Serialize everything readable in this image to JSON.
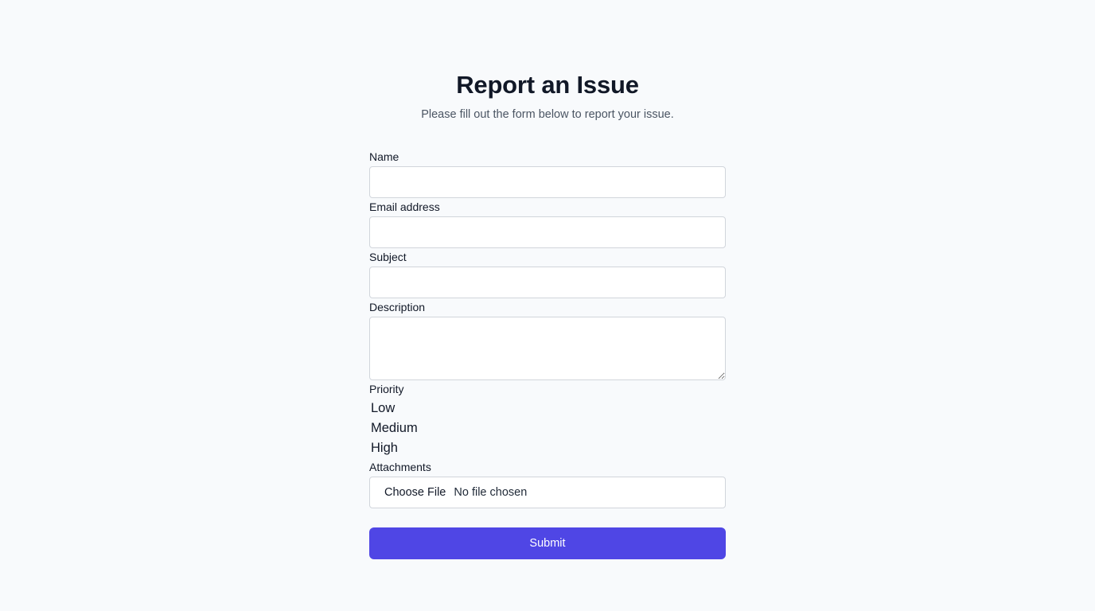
{
  "header": {
    "title": "Report an Issue",
    "subtitle": "Please fill out the form below to report your issue."
  },
  "form": {
    "name": {
      "label": "Name",
      "value": ""
    },
    "email": {
      "label": "Email address",
      "value": ""
    },
    "subject": {
      "label": "Subject",
      "value": ""
    },
    "description": {
      "label": "Description",
      "value": ""
    },
    "priority": {
      "label": "Priority",
      "options": [
        "Low",
        "Medium",
        "High"
      ]
    },
    "attachments": {
      "label": "Attachments",
      "button_label": "Choose File",
      "status": "No file chosen"
    },
    "submit_label": "Submit"
  },
  "colors": {
    "background": "#f8fafc",
    "accent": "#4f46e5",
    "input_border": "#d1d5db",
    "subtitle_text": "#4b5563"
  }
}
